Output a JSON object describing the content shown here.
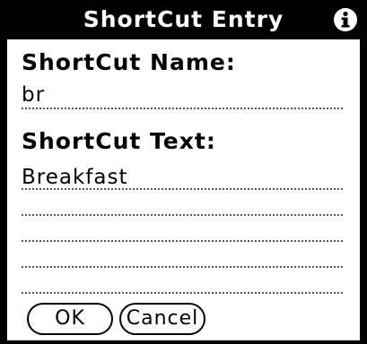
{
  "titlebar": {
    "title": "ShortCut Entry",
    "info_icon": "info-icon"
  },
  "form": {
    "name_label": "ShortCut Name:",
    "name_value": "br",
    "text_label": "ShortCut Text:",
    "text_value": "Breakfast"
  },
  "buttons": {
    "ok_label": "OK",
    "cancel_label": "Cancel"
  },
  "colors": {
    "background": "#ffffff",
    "foreground": "#000000"
  }
}
